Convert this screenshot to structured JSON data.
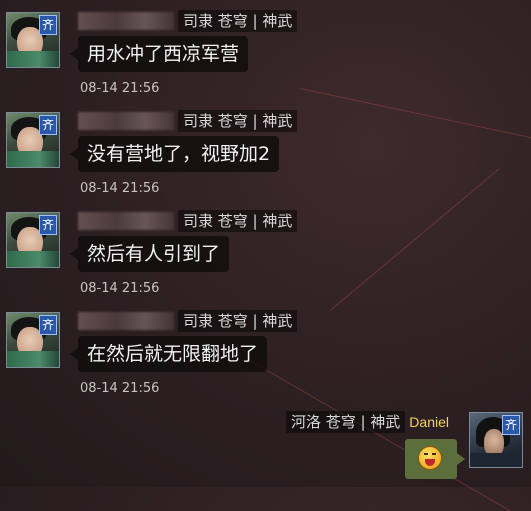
{
  "messages": [
    {
      "sender_tag": "司隶 苍穹 | 神武",
      "text": "用水冲了西凉军营",
      "time": "08-14 21:56",
      "badge": "齐"
    },
    {
      "sender_tag": "司隶 苍穹 | 神武",
      "text": "没有营地了，视野加2",
      "time": "08-14 21:56",
      "badge": "齐"
    },
    {
      "sender_tag": "司隶 苍穹 | 神武",
      "text": "然后有人引到了",
      "time": "08-14 21:56",
      "badge": "齐"
    },
    {
      "sender_tag": "司隶 苍穹 | 神武",
      "text": "在然后就无限翻地了",
      "time": "08-14 21:56",
      "badge": "齐"
    }
  ],
  "self_message": {
    "sender_tag": "河洛 苍穹 | 神武",
    "username": "Daniel",
    "badge": "齐",
    "content": "laughing-emoji"
  },
  "colors": {
    "username": "#f3d25a",
    "badge": "#2a58a8",
    "self_bubble": "#5c6e3a"
  }
}
